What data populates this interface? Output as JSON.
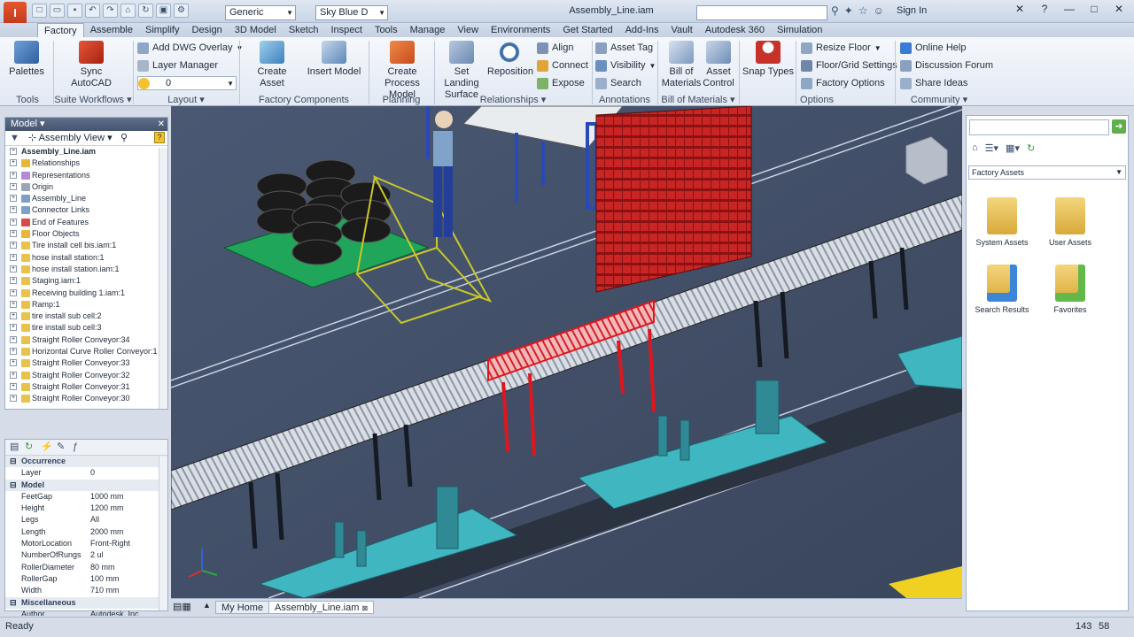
{
  "window": {
    "title": "Assembly_Line.iam",
    "app_letter": "I"
  },
  "qat": {
    "style_combo": "Generic",
    "color_combo": "Sky Blue D",
    "search_placeholder": "",
    "signin": "Sign In"
  },
  "tabs": [
    "Factory",
    "Assemble",
    "Simplify",
    "Design",
    "3D Model",
    "Sketch",
    "Inspect",
    "Tools",
    "Manage",
    "View",
    "Environments",
    "Get Started",
    "Add-Ins",
    "Vault",
    "Autodesk 360",
    "Simulation"
  ],
  "ribbon": {
    "palettes": "Palettes",
    "sync": [
      "Sync",
      "AutoCAD"
    ],
    "add_dwg": "Add DWG Overlay",
    "layer_manager": "Layer Manager",
    "layer_value": "0",
    "create_asset": "Create Asset",
    "insert_model": "Insert Model",
    "create_process": [
      "Create Process",
      "Model"
    ],
    "set_landing": [
      "Set Landing",
      "Surface"
    ],
    "reposition": "Reposition",
    "align": "Align",
    "connect": "Connect",
    "expose": "Expose",
    "asset_tag": "Asset Tag",
    "visibility": "Visibility",
    "search": "Search",
    "bom": [
      "Bill of",
      "Materials"
    ],
    "asset_control": [
      "Asset",
      "Control"
    ],
    "snap_types": "Snap Types",
    "resize_floor": "Resize Floor",
    "floor_grid": "Floor/Grid Settings",
    "factory_options": "Factory Options",
    "online_help": "Online Help",
    "discussion": "Discussion Forum",
    "share_ideas": "Share Ideas",
    "groups": {
      "tools": "Tools",
      "suite": "Suite Workflows",
      "layout": "Layout",
      "factory_components": "Factory Components",
      "planning": "Planning",
      "relationships": "Relationships",
      "annotations": "Annotations",
      "bom": "Bill of Materials",
      "options": "Options",
      "community": "Community"
    }
  },
  "model_panel": {
    "title": "Model",
    "view": "Assembly View",
    "root": "Assembly_Line.iam",
    "items": [
      "Relationships",
      "Representations",
      "Origin",
      "Assembly_Line",
      "Connector Links",
      "End of Features",
      "Floor Objects",
      "Tire install cell bis.iam:1",
      "hose install station:1",
      "hose install station.iam:1",
      "Staging.iam:1",
      "Receiving building 1.iam:1",
      "Ramp:1",
      "tire install sub cell:2",
      "tire install sub cell:3",
      "Straight Roller Conveyor:34",
      "Horizontal Curve Roller Conveyor:1",
      "Straight Roller Conveyor:33",
      "Straight Roller Conveyor:32",
      "Straight Roller Conveyor:31",
      "Straight Roller Conveyor:30"
    ]
  },
  "properties": {
    "cat_occurrence": "Occurrence",
    "layer": {
      "k": "Layer",
      "v": "0"
    },
    "cat_model": "Model",
    "rows": [
      {
        "k": "FeetGap",
        "v": "1000 mm"
      },
      {
        "k": "Height",
        "v": "1200 mm"
      },
      {
        "k": "Legs",
        "v": "All"
      },
      {
        "k": "Length",
        "v": "2000 mm"
      },
      {
        "k": "MotorLocation",
        "v": "Front-Right"
      },
      {
        "k": "NumberOfRungs",
        "v": "2 ul"
      },
      {
        "k": "RollerDiameter",
        "v": "80 mm"
      },
      {
        "k": "RollerGap",
        "v": "100 mm"
      },
      {
        "k": "Width",
        "v": "710 mm"
      }
    ],
    "cat_misc": "Miscellaneous",
    "author": {
      "k": "Author",
      "v": "Autodesk, Inc."
    }
  },
  "view_tabs": {
    "home": "My Home",
    "doc": "Assembly_Line.iam"
  },
  "assets": {
    "combo": "Factory Assets",
    "folders": [
      "System Assets",
      "User Assets",
      "Search Results",
      "Favorites"
    ]
  },
  "status": {
    "left": "Ready",
    "n1": "143",
    "n2": "58"
  }
}
